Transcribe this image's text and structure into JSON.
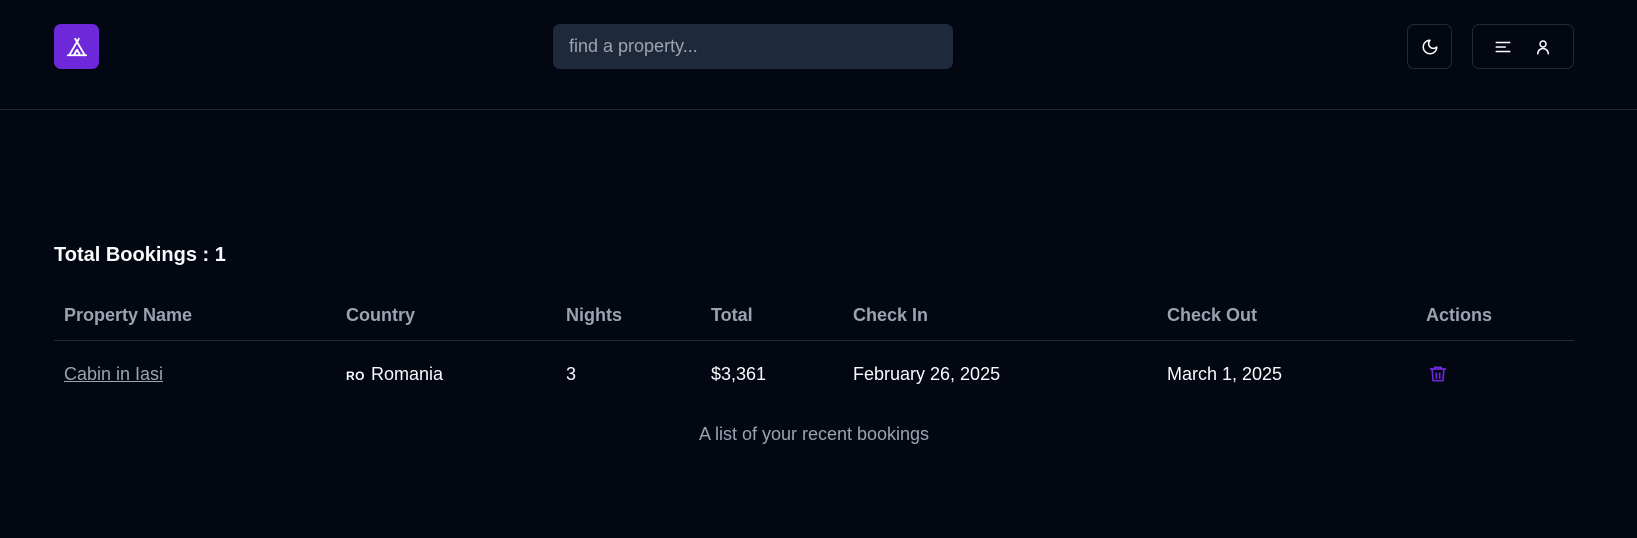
{
  "header": {
    "logo_icon": "tent-icon",
    "search_placeholder": "find a property...",
    "theme_icon": "moon-icon",
    "menu_icon": "menu-icon",
    "user_icon": "user-icon"
  },
  "bookings": {
    "heading": "Total Bookings : 1",
    "columns": [
      "Property Name",
      "Country",
      "Nights",
      "Total",
      "Check In",
      "Check Out",
      "Actions"
    ],
    "rows": [
      {
        "property": "Cabin in Iasi",
        "country_flag": "RO",
        "country": "Romania",
        "nights": "3",
        "total": "$3,361",
        "check_in": "February 26, 2025",
        "check_out": "March 1, 2025",
        "action_icon": "trash-icon"
      }
    ],
    "caption": "A list of your recent bookings"
  },
  "colors": {
    "accent": "#6d28d9",
    "background": "#030712",
    "search_bg": "#1e293b"
  }
}
